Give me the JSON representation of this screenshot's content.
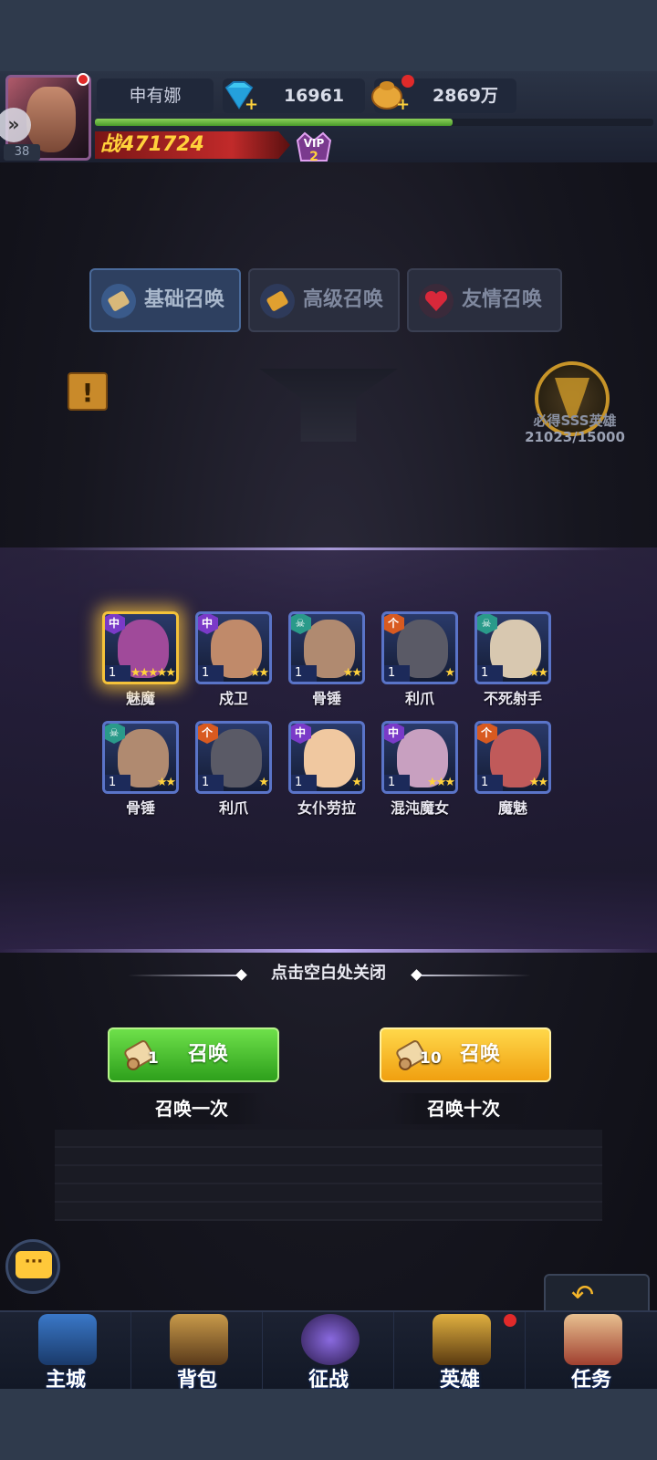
{
  "player": {
    "name": "申有娜",
    "level": "38",
    "gems": "16961",
    "gold": "2869万",
    "power_prefix": "战",
    "power": "471724",
    "vip_label": "VIP",
    "vip_level": "2",
    "exp_progress": 0.64
  },
  "tabs": [
    {
      "label": "基础召唤",
      "active": true
    },
    {
      "label": "高级召唤",
      "active": false
    },
    {
      "label": "友情召唤",
      "active": false
    }
  ],
  "goal": {
    "label": "必得SSS英雄",
    "progress": "21023/15000"
  },
  "heroes": [
    {
      "name": "魅魔",
      "level": "1",
      "stars": "★★★★★",
      "faction": "中",
      "highlight": true
    },
    {
      "name": "戍卫",
      "level": "1",
      "stars": "★★",
      "faction": "中",
      "highlight": false
    },
    {
      "name": "骨锤",
      "level": "1",
      "stars": "★★",
      "faction": "☠",
      "highlight": false
    },
    {
      "name": "利爪",
      "level": "1",
      "stars": "★",
      "faction": "个",
      "highlight": false
    },
    {
      "name": "不死射手",
      "level": "1",
      "stars": "★★",
      "faction": "☠",
      "highlight": false
    },
    {
      "name": "骨锤",
      "level": "1",
      "stars": "★★",
      "faction": "☠",
      "highlight": false
    },
    {
      "name": "利爪",
      "level": "1",
      "stars": "★",
      "faction": "个",
      "highlight": false
    },
    {
      "name": "女仆劳拉",
      "level": "1",
      "stars": "★",
      "faction": "中",
      "highlight": false
    },
    {
      "name": "混沌魔女",
      "level": "1",
      "stars": "★★★",
      "faction": "中",
      "highlight": false
    },
    {
      "name": "魔魅",
      "level": "1",
      "stars": "★★",
      "faction": "个",
      "highlight": false
    }
  ],
  "close_hint": "点击空白处关闭",
  "summon_once": {
    "count": "1",
    "button_label": "召唤",
    "caption": "召唤一次"
  },
  "summon_ten": {
    "count": "10",
    "button_label": "召唤",
    "caption": "召唤十次"
  },
  "back_label": "返回",
  "nav": [
    {
      "label": "主城",
      "dot": false
    },
    {
      "label": "背包",
      "dot": false
    },
    {
      "label": "征战",
      "dot": false
    },
    {
      "label": "英雄",
      "dot": true
    },
    {
      "label": "任务",
      "dot": false
    }
  ],
  "colors": {
    "accent_gold": "#ffd23c",
    "button_green": "#2ea01c",
    "button_yellow": "#f0a010",
    "hero_border": "#5a74c8"
  },
  "icons": {
    "gem": "diamond-icon",
    "gold": "coin-bag-icon",
    "chat": "chat-icon",
    "back": "back-arrow-icon"
  }
}
